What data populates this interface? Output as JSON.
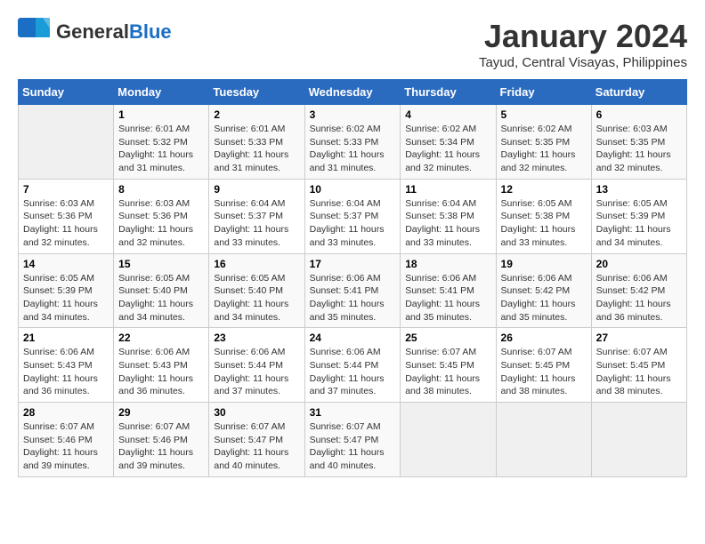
{
  "header": {
    "logo_general": "General",
    "logo_blue": "Blue",
    "month_title": "January 2024",
    "location": "Tayud, Central Visayas, Philippines"
  },
  "days_of_week": [
    "Sunday",
    "Monday",
    "Tuesday",
    "Wednesday",
    "Thursday",
    "Friday",
    "Saturday"
  ],
  "weeks": [
    [
      {
        "day": "",
        "sunrise": "",
        "sunset": "",
        "daylight": ""
      },
      {
        "day": "1",
        "sunrise": "Sunrise: 6:01 AM",
        "sunset": "Sunset: 5:32 PM",
        "daylight": "Daylight: 11 hours and 31 minutes."
      },
      {
        "day": "2",
        "sunrise": "Sunrise: 6:01 AM",
        "sunset": "Sunset: 5:33 PM",
        "daylight": "Daylight: 11 hours and 31 minutes."
      },
      {
        "day": "3",
        "sunrise": "Sunrise: 6:02 AM",
        "sunset": "Sunset: 5:33 PM",
        "daylight": "Daylight: 11 hours and 31 minutes."
      },
      {
        "day": "4",
        "sunrise": "Sunrise: 6:02 AM",
        "sunset": "Sunset: 5:34 PM",
        "daylight": "Daylight: 11 hours and 32 minutes."
      },
      {
        "day": "5",
        "sunrise": "Sunrise: 6:02 AM",
        "sunset": "Sunset: 5:35 PM",
        "daylight": "Daylight: 11 hours and 32 minutes."
      },
      {
        "day": "6",
        "sunrise": "Sunrise: 6:03 AM",
        "sunset": "Sunset: 5:35 PM",
        "daylight": "Daylight: 11 hours and 32 minutes."
      }
    ],
    [
      {
        "day": "7",
        "sunrise": "Sunrise: 6:03 AM",
        "sunset": "Sunset: 5:36 PM",
        "daylight": "Daylight: 11 hours and 32 minutes."
      },
      {
        "day": "8",
        "sunrise": "Sunrise: 6:03 AM",
        "sunset": "Sunset: 5:36 PM",
        "daylight": "Daylight: 11 hours and 32 minutes."
      },
      {
        "day": "9",
        "sunrise": "Sunrise: 6:04 AM",
        "sunset": "Sunset: 5:37 PM",
        "daylight": "Daylight: 11 hours and 33 minutes."
      },
      {
        "day": "10",
        "sunrise": "Sunrise: 6:04 AM",
        "sunset": "Sunset: 5:37 PM",
        "daylight": "Daylight: 11 hours and 33 minutes."
      },
      {
        "day": "11",
        "sunrise": "Sunrise: 6:04 AM",
        "sunset": "Sunset: 5:38 PM",
        "daylight": "Daylight: 11 hours and 33 minutes."
      },
      {
        "day": "12",
        "sunrise": "Sunrise: 6:05 AM",
        "sunset": "Sunset: 5:38 PM",
        "daylight": "Daylight: 11 hours and 33 minutes."
      },
      {
        "day": "13",
        "sunrise": "Sunrise: 6:05 AM",
        "sunset": "Sunset: 5:39 PM",
        "daylight": "Daylight: 11 hours and 34 minutes."
      }
    ],
    [
      {
        "day": "14",
        "sunrise": "Sunrise: 6:05 AM",
        "sunset": "Sunset: 5:39 PM",
        "daylight": "Daylight: 11 hours and 34 minutes."
      },
      {
        "day": "15",
        "sunrise": "Sunrise: 6:05 AM",
        "sunset": "Sunset: 5:40 PM",
        "daylight": "Daylight: 11 hours and 34 minutes."
      },
      {
        "day": "16",
        "sunrise": "Sunrise: 6:05 AM",
        "sunset": "Sunset: 5:40 PM",
        "daylight": "Daylight: 11 hours and 34 minutes."
      },
      {
        "day": "17",
        "sunrise": "Sunrise: 6:06 AM",
        "sunset": "Sunset: 5:41 PM",
        "daylight": "Daylight: 11 hours and 35 minutes."
      },
      {
        "day": "18",
        "sunrise": "Sunrise: 6:06 AM",
        "sunset": "Sunset: 5:41 PM",
        "daylight": "Daylight: 11 hours and 35 minutes."
      },
      {
        "day": "19",
        "sunrise": "Sunrise: 6:06 AM",
        "sunset": "Sunset: 5:42 PM",
        "daylight": "Daylight: 11 hours and 35 minutes."
      },
      {
        "day": "20",
        "sunrise": "Sunrise: 6:06 AM",
        "sunset": "Sunset: 5:42 PM",
        "daylight": "Daylight: 11 hours and 36 minutes."
      }
    ],
    [
      {
        "day": "21",
        "sunrise": "Sunrise: 6:06 AM",
        "sunset": "Sunset: 5:43 PM",
        "daylight": "Daylight: 11 hours and 36 minutes."
      },
      {
        "day": "22",
        "sunrise": "Sunrise: 6:06 AM",
        "sunset": "Sunset: 5:43 PM",
        "daylight": "Daylight: 11 hours and 36 minutes."
      },
      {
        "day": "23",
        "sunrise": "Sunrise: 6:06 AM",
        "sunset": "Sunset: 5:44 PM",
        "daylight": "Daylight: 11 hours and 37 minutes."
      },
      {
        "day": "24",
        "sunrise": "Sunrise: 6:06 AM",
        "sunset": "Sunset: 5:44 PM",
        "daylight": "Daylight: 11 hours and 37 minutes."
      },
      {
        "day": "25",
        "sunrise": "Sunrise: 6:07 AM",
        "sunset": "Sunset: 5:45 PM",
        "daylight": "Daylight: 11 hours and 38 minutes."
      },
      {
        "day": "26",
        "sunrise": "Sunrise: 6:07 AM",
        "sunset": "Sunset: 5:45 PM",
        "daylight": "Daylight: 11 hours and 38 minutes."
      },
      {
        "day": "27",
        "sunrise": "Sunrise: 6:07 AM",
        "sunset": "Sunset: 5:45 PM",
        "daylight": "Daylight: 11 hours and 38 minutes."
      }
    ],
    [
      {
        "day": "28",
        "sunrise": "Sunrise: 6:07 AM",
        "sunset": "Sunset: 5:46 PM",
        "daylight": "Daylight: 11 hours and 39 minutes."
      },
      {
        "day": "29",
        "sunrise": "Sunrise: 6:07 AM",
        "sunset": "Sunset: 5:46 PM",
        "daylight": "Daylight: 11 hours and 39 minutes."
      },
      {
        "day": "30",
        "sunrise": "Sunrise: 6:07 AM",
        "sunset": "Sunset: 5:47 PM",
        "daylight": "Daylight: 11 hours and 40 minutes."
      },
      {
        "day": "31",
        "sunrise": "Sunrise: 6:07 AM",
        "sunset": "Sunset: 5:47 PM",
        "daylight": "Daylight: 11 hours and 40 minutes."
      },
      {
        "day": "",
        "sunrise": "",
        "sunset": "",
        "daylight": ""
      },
      {
        "day": "",
        "sunrise": "",
        "sunset": "",
        "daylight": ""
      },
      {
        "day": "",
        "sunrise": "",
        "sunset": "",
        "daylight": ""
      }
    ]
  ]
}
